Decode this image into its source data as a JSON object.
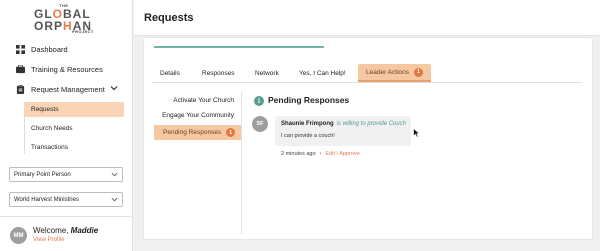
{
  "logo": {
    "line_the": "THE",
    "line1_a": "GL",
    "line1_o": "O",
    "line1_b": "BAL",
    "line2_a": "ORP",
    "line2_o": "H",
    "line2_b": "AN",
    "line3": "PROJECT"
  },
  "sidebar": {
    "items": [
      {
        "label": "Dashboard",
        "icon": "dashboard-icon"
      },
      {
        "label": "Training & Resources",
        "icon": "briefcase-icon"
      },
      {
        "label": "Request Management",
        "icon": "clipboard-icon"
      }
    ],
    "subitems": [
      {
        "label": "Requests",
        "active": true
      },
      {
        "label": "Church Needs",
        "active": false
      },
      {
        "label": "Transactions",
        "active": false
      }
    ],
    "role_select": "Primary Point Person",
    "org_select": "World Harvest Ministries",
    "user": {
      "initials": "MM",
      "welcome": "Welcome,",
      "name": "Maddie",
      "view_profile": "View Profile"
    }
  },
  "header": {
    "title": "Requests"
  },
  "tabs": [
    {
      "label": "Details"
    },
    {
      "label": "Responses"
    },
    {
      "label": "Network"
    },
    {
      "label": "Yes, I Can Help!"
    },
    {
      "label": "Leader Actions",
      "badge": "1",
      "active": true
    }
  ],
  "vtabs": [
    {
      "label": "Activate Your Church"
    },
    {
      "label": "Engage Your Community"
    },
    {
      "label": "Pending Responses",
      "badge": "1",
      "active": true
    }
  ],
  "pending": {
    "title": "Pending Responses",
    "response": {
      "initials": "SF",
      "name": "Shaunie Frimpong",
      "status": "is willing to provide Couch",
      "message": "I can provide a couch!",
      "time": "2 minutes ago",
      "action": "Edit / Approve"
    }
  },
  "colors": {
    "accent": "#e57c4b",
    "teal": "#5a9d93",
    "active_bg": "#f6c8a1"
  }
}
